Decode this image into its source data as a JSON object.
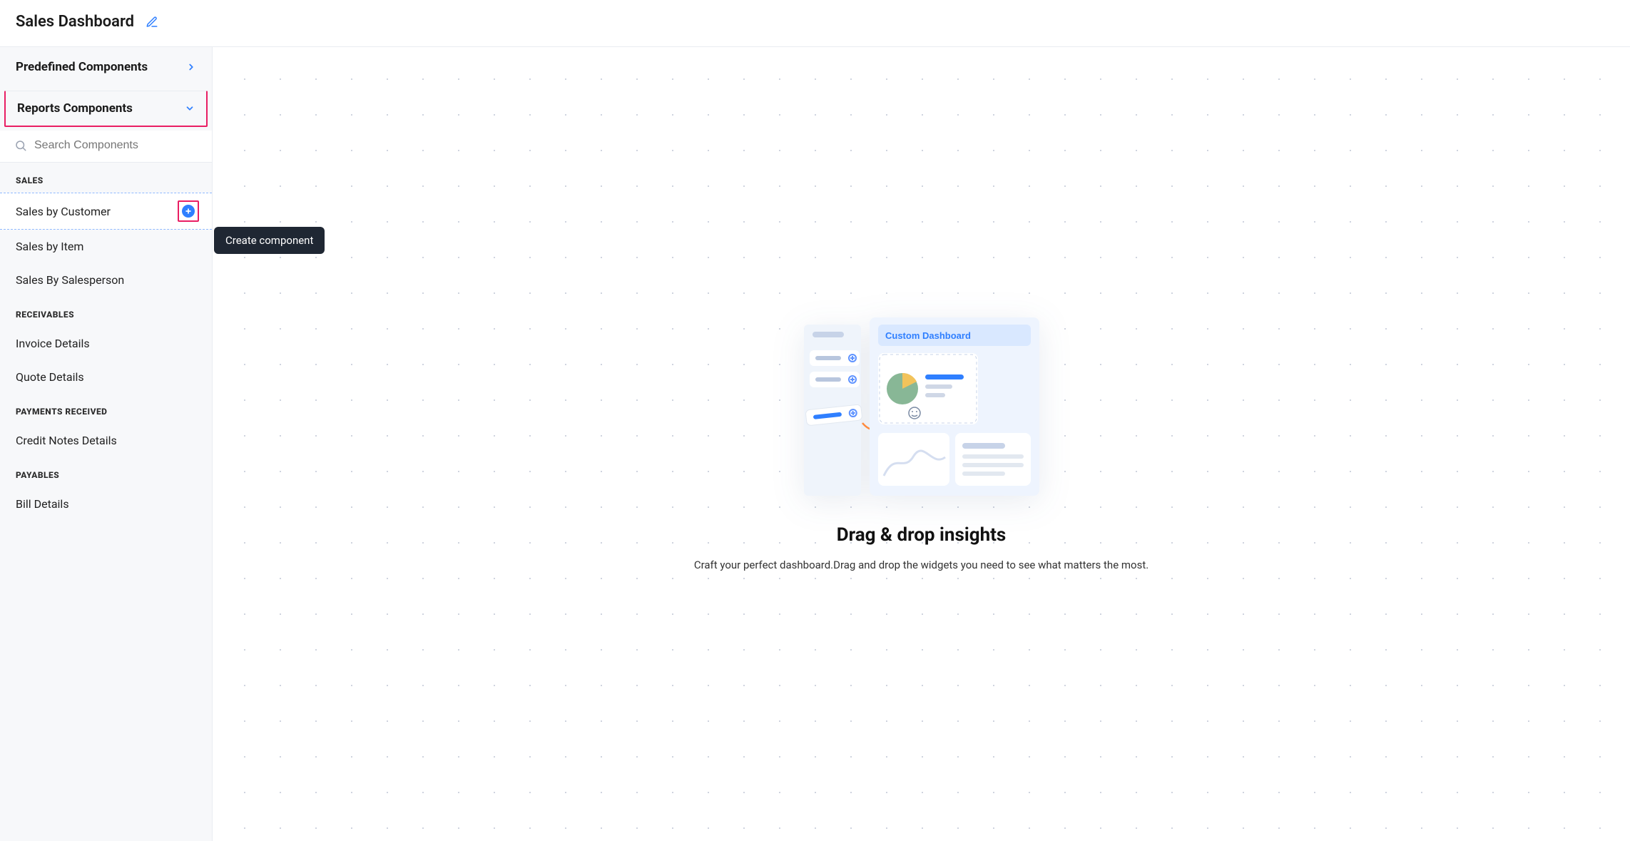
{
  "header": {
    "title": "Sales Dashboard"
  },
  "sidebar": {
    "panels": {
      "predefined": {
        "label": "Predefined Components",
        "expanded": false
      },
      "reports": {
        "label": "Reports Components",
        "expanded": true
      }
    },
    "search": {
      "placeholder": "Search Components"
    },
    "sections": [
      {
        "label": "SALES",
        "items": [
          {
            "label": "Sales by Customer",
            "selected": true,
            "showAdd": true
          },
          {
            "label": "Sales by Item"
          },
          {
            "label": "Sales By Salesperson"
          }
        ]
      },
      {
        "label": "RECEIVABLES",
        "items": [
          {
            "label": "Invoice Details"
          },
          {
            "label": "Quote Details"
          }
        ]
      },
      {
        "label": "PAYMENTS RECEIVED",
        "items": [
          {
            "label": "Credit Notes Details"
          }
        ]
      },
      {
        "label": "PAYABLES",
        "items": [
          {
            "label": "Bill Details"
          }
        ]
      }
    ]
  },
  "tooltip": {
    "text": "Create component"
  },
  "canvas": {
    "illus_title": "Custom Dashboard",
    "headline": "Drag & drop insights",
    "subline": "Craft your perfect dashboard.Drag and drop the widgets you need to see what matters the most."
  }
}
